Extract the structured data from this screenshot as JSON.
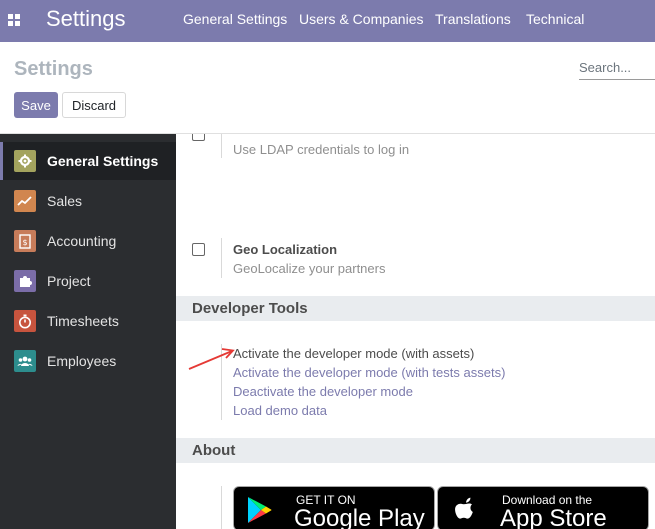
{
  "navbar": {
    "app_name": "Settings",
    "menu": [
      "General Settings",
      "Users & Companies",
      "Translations",
      "Technical"
    ]
  },
  "control_panel": {
    "breadcrumb": "Settings",
    "search_placeholder": "Search...",
    "save_label": "Save",
    "discard_label": "Discard"
  },
  "sidebar": {
    "items": [
      {
        "label": "General Settings",
        "icon": "gear-icon",
        "color": "#a3a35e"
      },
      {
        "label": "Sales",
        "icon": "chart-icon",
        "color": "#d1864f"
      },
      {
        "label": "Accounting",
        "icon": "invoice-icon",
        "color": "#c77c5a"
      },
      {
        "label": "Project",
        "icon": "puzzle-icon",
        "color": "#7b6da8"
      },
      {
        "label": "Timesheets",
        "icon": "stopwatch-icon",
        "color": "#c7543e"
      },
      {
        "label": "Employees",
        "icon": "people-icon",
        "color": "#2d8d8d"
      }
    ]
  },
  "settings": {
    "ldap_desc": "Use LDAP credentials to log in",
    "geo_title": "Geo Localization",
    "geo_desc": "GeoLocalize your partners"
  },
  "developer_tools": {
    "heading": "Developer Tools",
    "links": [
      "Activate the developer mode (with assets)",
      "Activate the developer mode (with tests assets)",
      "Deactivate the developer mode",
      "Load demo data"
    ]
  },
  "about": {
    "heading": "About",
    "google_small": "GET IT ON",
    "google_big": "Google Play",
    "apple_small": "Download on the",
    "apple_big": "App Store"
  },
  "colors": {
    "brand": "#7c7bad",
    "sidebar_bg": "#2b2d30",
    "annotation_arrow": "#e53935"
  }
}
